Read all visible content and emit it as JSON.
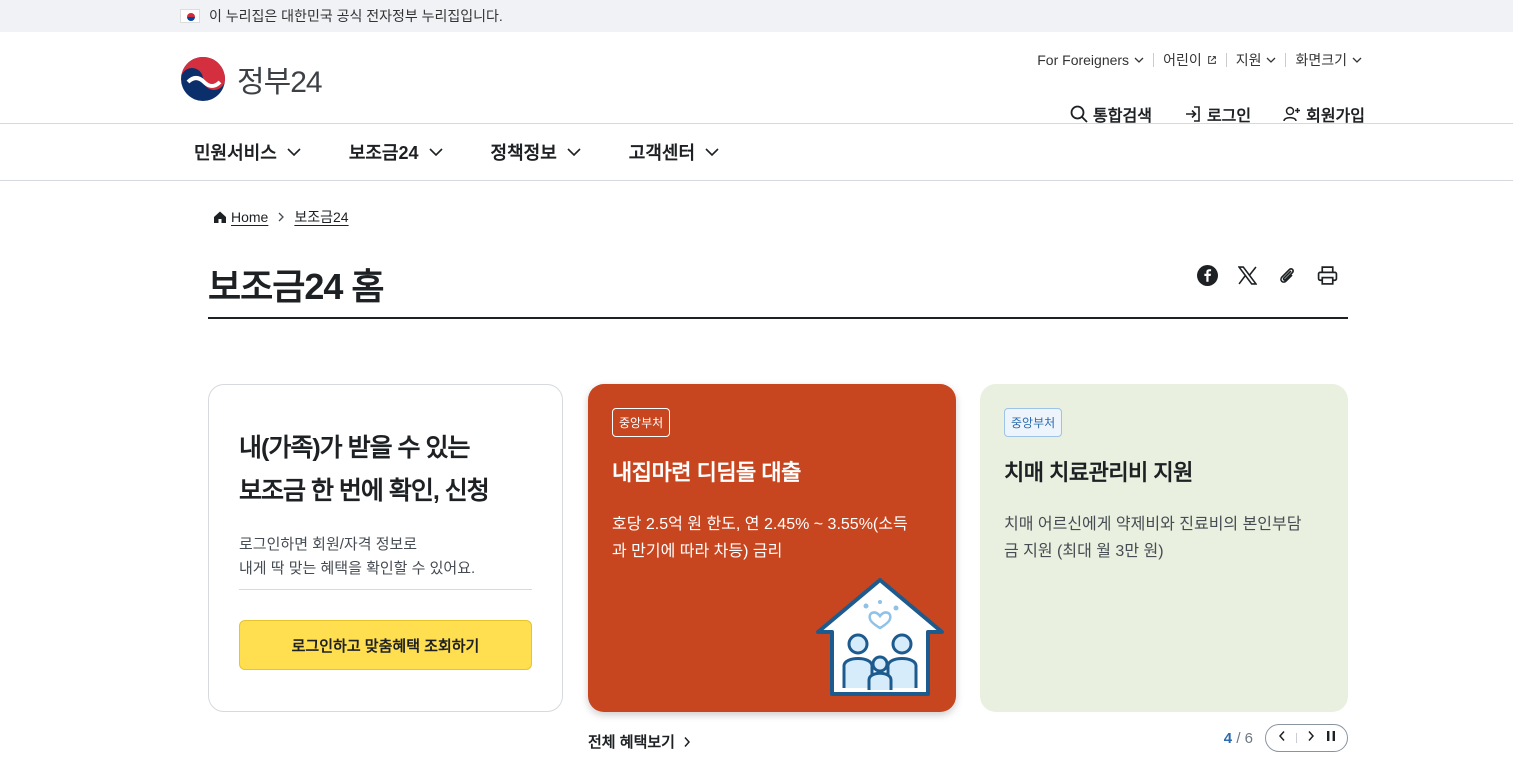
{
  "topbar": {
    "notice": "이 누리집은 대한민국 공식 전자정부 누리집입니다."
  },
  "logo": {
    "text": "정부24"
  },
  "util": {
    "foreigners": "For Foreigners",
    "kids": "어린이",
    "support": "지원",
    "screen_size": "화면크기"
  },
  "actions": {
    "search": "통합검색",
    "login": "로그인",
    "signup": "회원가입"
  },
  "gnb": [
    {
      "label": "민원서비스"
    },
    {
      "label": "보조금24"
    },
    {
      "label": "정책정보"
    },
    {
      "label": "고객센터"
    }
  ],
  "breadcrumb": {
    "home": "Home",
    "current": "보조금24"
  },
  "page": {
    "title": "보조금24 홈"
  },
  "login_card": {
    "title_line1": "내(가족)가 받을 수 있는",
    "title_line2": "보조금 한 번에 확인, 신청",
    "desc_line1": "로그인하면 회원/자격 정보로",
    "desc_line2": "내게 딱 맞는 혜택을 확인할 수 있어요.",
    "button": "로그인하고 맞춤혜택 조회하기"
  },
  "cards": [
    {
      "badge": "중앙부처",
      "title": "내집마련 디딤돌 대출",
      "desc": "호당 2.5억 원 한도, 연 2.45% ~ 3.55%(소득과 만기에 따라 차등) 금리",
      "icon": "family-house-icon",
      "color": "#c7461f"
    },
    {
      "badge": "중앙부처",
      "title": "치매 치료관리비 지원",
      "desc": "치매 어르신에게 약제비와 진료비의 본인부담금 지원 (최대 월 3만 원)",
      "color": "#e9f0df"
    }
  ],
  "all_benefits": "전체 혜택보기",
  "pager": {
    "current": "4",
    "separator": "/",
    "total": "6"
  }
}
